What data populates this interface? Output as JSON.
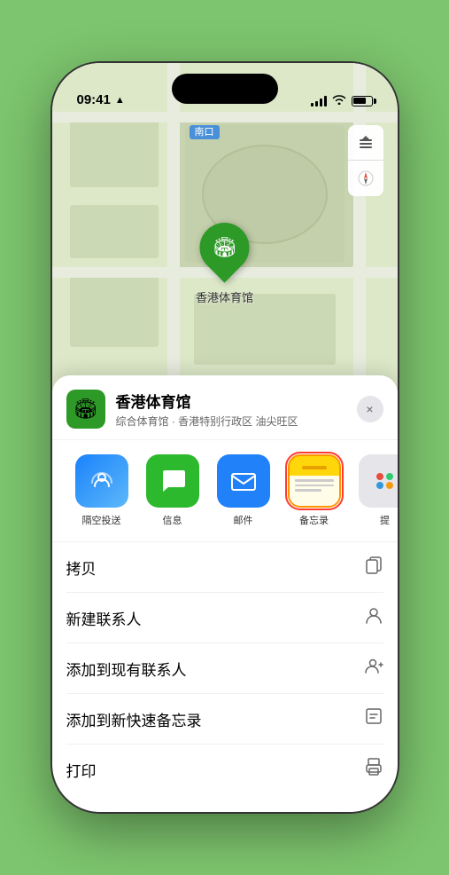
{
  "status": {
    "time": "09:41",
    "location_arrow": "▲"
  },
  "map": {
    "label_text": "南口",
    "location_name": "香港体育馆",
    "map_icon": "🏟"
  },
  "map_controls": {
    "layers_icon": "🗺",
    "compass_icon": "↑"
  },
  "sheet": {
    "venue_icon": "🏟",
    "venue_name": "香港体育馆",
    "venue_desc": "综合体育馆 · 香港特别行政区 油尖旺区",
    "close_label": "×"
  },
  "share_items": [
    {
      "id": "airdrop",
      "label": "隔空投送",
      "type": "airdrop"
    },
    {
      "id": "messages",
      "label": "信息",
      "type": "messages"
    },
    {
      "id": "mail",
      "label": "邮件",
      "type": "mail"
    },
    {
      "id": "notes",
      "label": "备忘录",
      "type": "notes",
      "selected": true
    },
    {
      "id": "more",
      "label": "提",
      "type": "more"
    }
  ],
  "actions": [
    {
      "id": "copy",
      "label": "拷贝",
      "icon": "📋"
    },
    {
      "id": "new-contact",
      "label": "新建联系人",
      "icon": "👤"
    },
    {
      "id": "add-existing",
      "label": "添加到现有联系人",
      "icon": "👤"
    },
    {
      "id": "add-notes",
      "label": "添加到新快速备忘录",
      "icon": "📝"
    },
    {
      "id": "print",
      "label": "打印",
      "icon": "🖨"
    }
  ]
}
